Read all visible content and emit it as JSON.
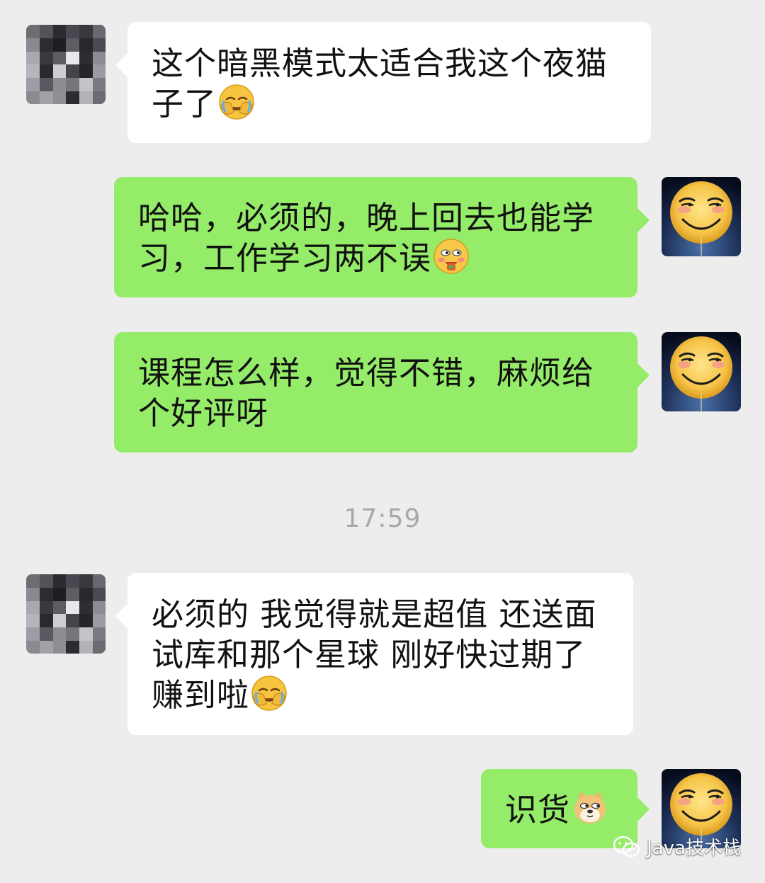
{
  "chat": {
    "messages": [
      {
        "sender": "contact",
        "lines": [
          "这个暗黑模式太适合我这个夜猫",
          "子了"
        ],
        "emoji": "facepalm-emoji"
      },
      {
        "sender": "me",
        "lines": [
          "哈哈，必须的，晚上回去也能学",
          "习，工作学习两不误"
        ],
        "emoji": "happy-nosebleed-emoji"
      },
      {
        "sender": "me",
        "lines": [
          "课程怎么样，觉得不错，麻烦给",
          "个好评呀"
        ]
      },
      {
        "sender": "contact",
        "lines": [
          "必须的 我觉得就是超值 还送面",
          "试库和那个星球 刚好快过期了",
          "赚到啦"
        ],
        "emoji": "facepalm-emoji"
      },
      {
        "sender": "me",
        "lines": [
          "识货"
        ],
        "emoji": "doge-emoji"
      }
    ],
    "timestamp": "17:59"
  },
  "watermark": {
    "text": "Java技术栈",
    "icon": "wechat-official-account-icon"
  },
  "colors": {
    "background": "#ededed",
    "incoming_bubble": "#ffffff",
    "outgoing_bubble": "#95ec69",
    "timestamp": "#a8a8a8"
  }
}
